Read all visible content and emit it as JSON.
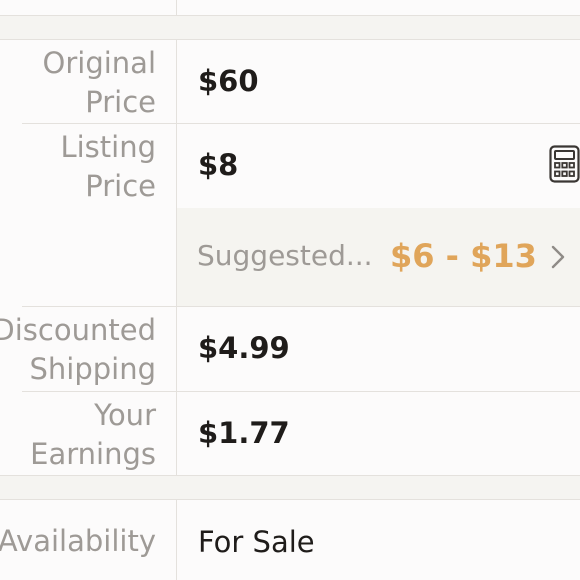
{
  "fields": [
    {
      "label_line1": "Original",
      "label_line2": "Price",
      "value": "$60"
    },
    {
      "label_line1": "Listing",
      "label_line2": "Price",
      "value": "$8"
    },
    {
      "label_line1": "Discounted",
      "label_line2": "Shipping",
      "value": "$4.99"
    },
    {
      "label_line1": "Your",
      "label_line2": "Earnings",
      "value": "$1.77"
    }
  ],
  "suggested": {
    "label": "Suggested...",
    "range": "$6 - $13"
  },
  "availability": {
    "label": "Availability",
    "value": "For Sale"
  },
  "icons": {
    "calculator": "calculator-icon",
    "chevron": "chevron-right-icon"
  },
  "colors": {
    "label": "#9e9a96",
    "value": "#1f1c1a",
    "accent": "#e0a55a",
    "band": "#f5f4f1"
  }
}
